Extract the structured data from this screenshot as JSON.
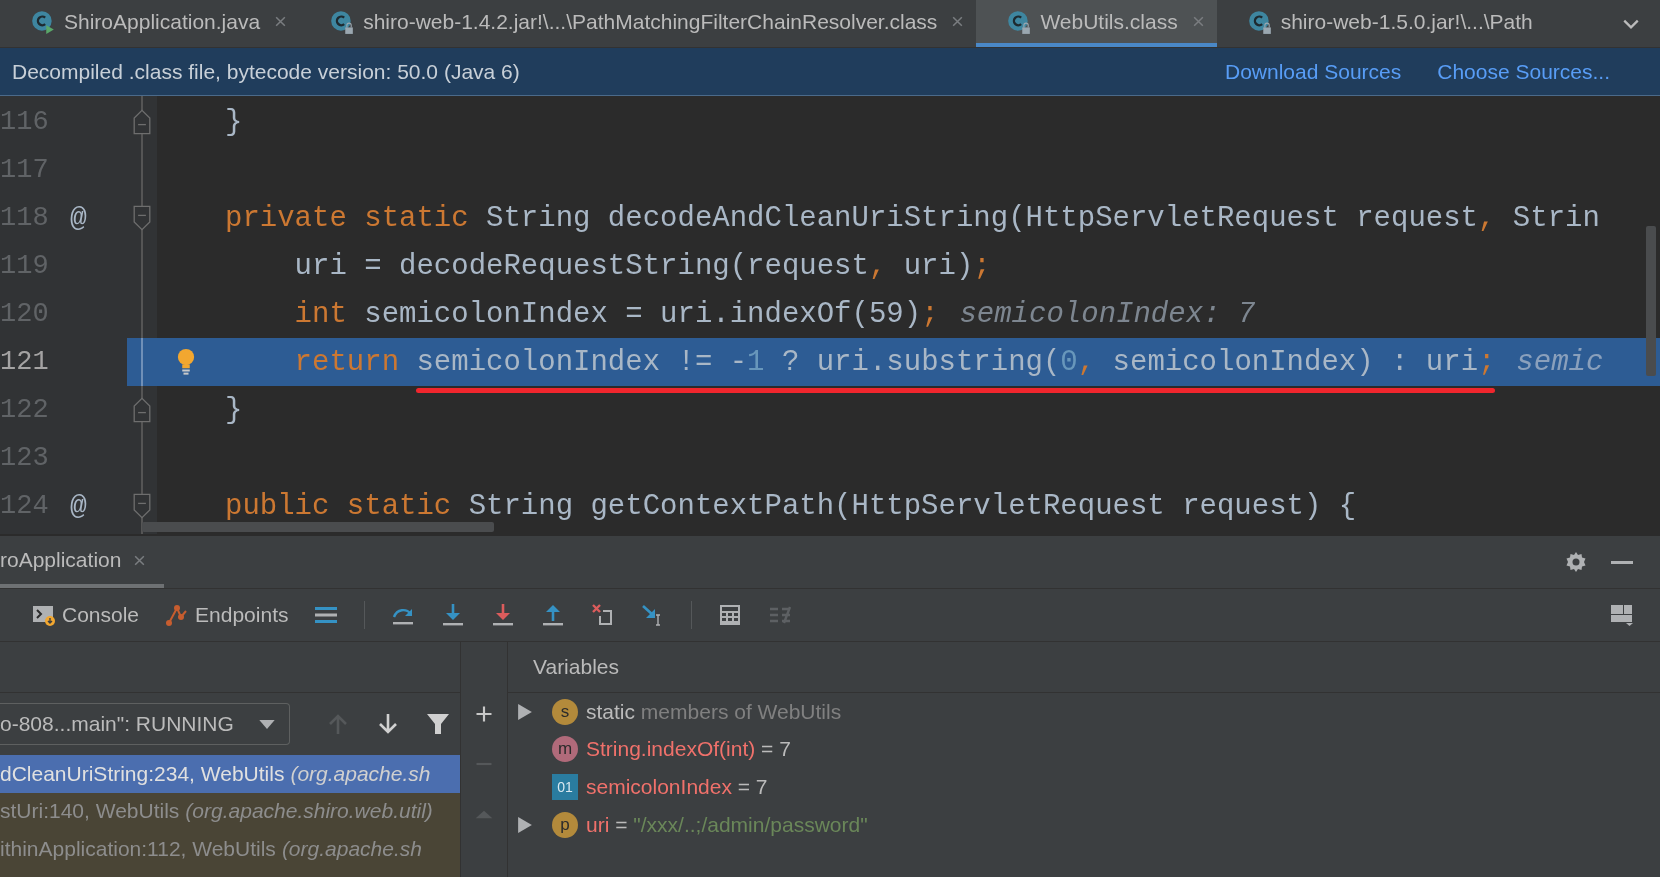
{
  "tabs": [
    {
      "label": "ShiroApplication.java",
      "selected": false,
      "closable": true
    },
    {
      "label": "shiro-web-1.4.2.jar!\\...\\PathMatchingFilterChainResolver.class",
      "selected": false,
      "closable": true
    },
    {
      "label": "WebUtils.class",
      "selected": true,
      "closable": true
    },
    {
      "label": "shiro-web-1.5.0.jar!\\...\\Path",
      "selected": false,
      "closable": false
    }
  ],
  "banner": {
    "text": "Decompiled .class file, bytecode version: 50.0 (Java 6)",
    "links": [
      "Download Sources",
      "Choose Sources..."
    ]
  },
  "editor": {
    "lines": [
      {
        "number": "116",
        "kind": "block-end",
        "current": false,
        "tokens": [
          {
            "kind": "plain",
            "text": "}"
          }
        ]
      },
      {
        "number": "117",
        "kind": "body",
        "current": false
      },
      {
        "number": "118",
        "annotation": "@",
        "kind": "block-start",
        "current": false,
        "tokens": [
          {
            "kind": "keyword",
            "text": "private static "
          },
          {
            "kind": "plain",
            "text": "String decodeAndCleanUriString(HttpServletRequest request"
          },
          {
            "kind": "keyword",
            "text": ","
          },
          {
            "kind": "plain",
            "text": " Strin"
          }
        ]
      },
      {
        "number": "119",
        "kind": "body",
        "current": false,
        "tokens": [
          {
            "kind": "plain",
            "text": "    uri = decodeRequestString(request"
          },
          {
            "kind": "keyword",
            "text": ","
          },
          {
            "kind": "plain",
            "text": " uri)"
          },
          {
            "kind": "keyword",
            "text": ";"
          }
        ]
      },
      {
        "number": "120",
        "kind": "body",
        "current": false,
        "tokens": [
          {
            "kind": "keyword",
            "text": "    int "
          },
          {
            "kind": "plain",
            "text": "semicolonIndex = uri.indexOf(59)"
          },
          {
            "kind": "keyword",
            "text": ";"
          },
          {
            "kind": "hint",
            "text": "semicolonIndex: 7"
          }
        ]
      },
      {
        "number": "121",
        "kind": "body",
        "current": true,
        "underlined": true,
        "tokens": [
          {
            "kind": "keyword",
            "text": "    return "
          },
          {
            "kind": "plain",
            "text": "semicolonIndex != -"
          },
          {
            "kind": "number",
            "text": "1"
          },
          {
            "kind": "plain",
            "text": " ? uri.substring("
          },
          {
            "kind": "number",
            "text": "0"
          },
          {
            "kind": "keyword",
            "text": ","
          },
          {
            "kind": "plain",
            "text": " semicolonIndex) : uri"
          },
          {
            "kind": "keyword",
            "text": ";"
          },
          {
            "kind": "hint",
            "text": "semic"
          }
        ]
      },
      {
        "number": "122",
        "kind": "block-end",
        "current": false,
        "tokens": [
          {
            "kind": "plain",
            "text": "}"
          }
        ]
      },
      {
        "number": "123",
        "kind": "body",
        "current": false
      },
      {
        "number": "124",
        "annotation": "@",
        "kind": "block-start",
        "current": false,
        "tokens": [
          {
            "kind": "keyword",
            "text": "public static "
          },
          {
            "kind": "plain",
            "text": "String getContextPath(HttpServletRequest request) {"
          }
        ]
      }
    ]
  },
  "debug": {
    "session_tab": {
      "label": "roApplication",
      "selected": true
    },
    "tool_tabs": [
      {
        "label": "Console"
      },
      {
        "label": "Endpoints"
      }
    ],
    "thread": {
      "value": "o-808...main\": RUNNING"
    },
    "frames": [
      {
        "method": "dCleanUriString:234, WebUtils",
        "package": "(org.apache.sh",
        "selected": true
      },
      {
        "method": "stUri:140, WebUtils",
        "package": "(org.apache.shiro.web.util)",
        "selected": false
      },
      {
        "method": "ithinApplication:112, WebUtils",
        "package": "(org.apache.sh",
        "selected": false
      }
    ],
    "variables_title": "Variables",
    "variables": [
      {
        "badge": "s",
        "kind": "static",
        "expandable": true,
        "changed": false,
        "name": "static",
        "detail": "members of WebUtils"
      },
      {
        "badge": "m",
        "kind": "method",
        "expandable": false,
        "changed": true,
        "name": "String.indexOf(int)",
        "separator": "=",
        "value": "7"
      },
      {
        "badge": "01",
        "kind": "field",
        "expandable": false,
        "changed": true,
        "name": "semicolonIndex",
        "separator": "=",
        "value": "7"
      },
      {
        "badge": "p",
        "kind": "param",
        "expandable": true,
        "changed": true,
        "name": "uri",
        "separator": "=",
        "string_value": "\"/xxx/..;/admin/password\""
      }
    ]
  }
}
